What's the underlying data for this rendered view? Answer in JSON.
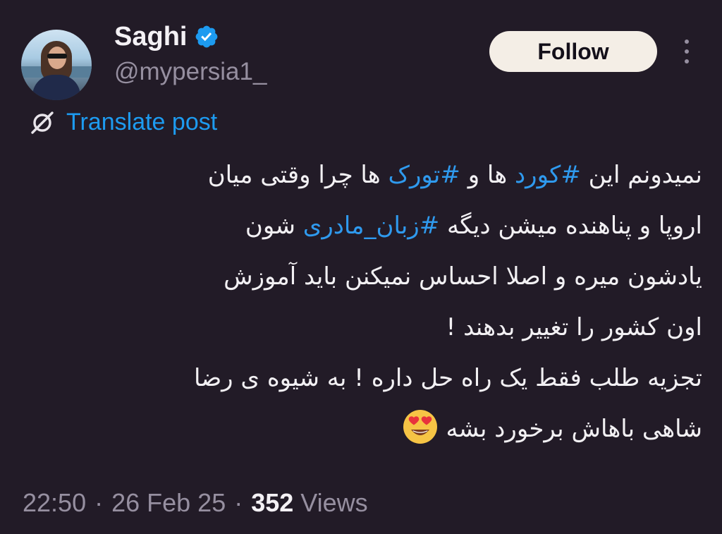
{
  "author": {
    "name": "Saghi",
    "handle": "@mypersia1_",
    "verified_color": "#1d9bf0"
  },
  "actions": {
    "follow_label": "Follow",
    "more_icon": "more-vertical-icon"
  },
  "translate": {
    "icon": "translate-icon",
    "label": "Translate post"
  },
  "post": {
    "line1": {
      "a": "نمیدونم این ",
      "tag1": "#کورد",
      "b": " ها و ",
      "tag2": "#تورک",
      "c": " ها چرا وقتی میان"
    },
    "line2": {
      "a": "اروپا و پناهنده میشن دیگه ",
      "tag3": "#زبان_مادری",
      "b": " شون"
    },
    "line3": "یادشون میره و اصلا احساس نمیکنن باید آموزش",
    "line4": "اون کشور را تغییر بدهند !",
    "line5": "تجزیه طلب فقط یک راه حل داره ! به شیوه ی رضا",
    "line6": "شاهی باهاش برخورد بشه",
    "emoji": "heart-eyes-emoji"
  },
  "meta": {
    "time": "22:50",
    "separator": "·",
    "date": "26 Feb 25",
    "views_count": "352",
    "views_label": "Views"
  },
  "colors": {
    "background": "#221b27",
    "link": "#1d9bf0",
    "muted": "#968fa0",
    "follow_bg": "#f4eee6"
  }
}
